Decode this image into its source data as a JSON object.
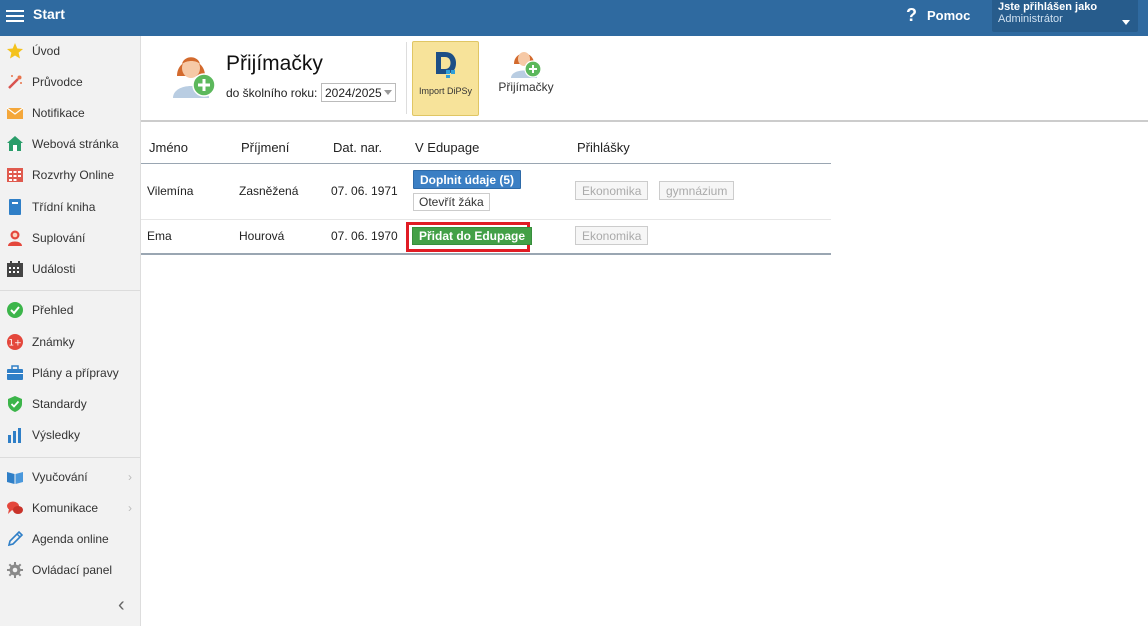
{
  "topbar": {
    "title": "Start",
    "help_label": "Pomoc",
    "help_icon": "?",
    "user_label": "Jste přihlášen jako",
    "user_name": "Administrátor",
    "bg_color": "#2f6aa0"
  },
  "sidebar": {
    "items": [
      {
        "label": "Úvod",
        "icon": "star-icon"
      },
      {
        "label": "Průvodce",
        "icon": "magic-wand-icon"
      },
      {
        "label": "Notifikace",
        "icon": "envelope-icon"
      },
      {
        "label": "Webová stránka",
        "icon": "house-icon"
      },
      {
        "label": "Rozvrhy Online",
        "icon": "timetable-icon"
      },
      {
        "label": "Třídní kniha",
        "icon": "book-icon"
      },
      {
        "label": "Suplování",
        "icon": "substitute-person-icon"
      },
      {
        "label": "Události",
        "icon": "calendar-icon"
      },
      {
        "label": "Přehled",
        "icon": "check-circle-icon"
      },
      {
        "label": "Známky",
        "icon": "grades-icon"
      },
      {
        "label": "Plány a přípravy",
        "icon": "briefcase-icon"
      },
      {
        "label": "Standardy",
        "icon": "shield-check-icon"
      },
      {
        "label": "Výsledky",
        "icon": "bar-chart-icon"
      },
      {
        "label": "Vyučování",
        "icon": "open-book-icon",
        "arrow": "›"
      },
      {
        "label": "Komunikace",
        "icon": "chat-bubbles-icon",
        "arrow": "›"
      },
      {
        "label": "Agenda online",
        "icon": "pen-icon"
      },
      {
        "label": "Ovládací panel",
        "icon": "gear-icon"
      }
    ],
    "collapse_glyph": "‹"
  },
  "header": {
    "title": "Přijímačky",
    "year_label": "do školního roku:",
    "year_value": "2024/2025",
    "import_label": "Import DiPSy",
    "tool_label": "Přijímačky"
  },
  "table": {
    "columns": [
      "Jméno",
      "Příjmení",
      "Dat. nar.",
      "V Edupage",
      "Přihlášky"
    ],
    "rows": [
      {
        "first": "Vilemína",
        "last": "Zasněžená",
        "dob": "07. 06. 1971",
        "actions": [
          "Doplnit údaje (5)",
          "Otevřít žáka"
        ],
        "applications": [
          "Ekonomika",
          "gymnázium"
        ]
      },
      {
        "first": "Ema",
        "last": "Hourová",
        "dob": "07. 06. 1970",
        "actions": [
          "Přidat do Edupage"
        ],
        "applications": [
          "Ekonomika"
        ]
      }
    ]
  },
  "colors": {
    "accent_blue": "#3b7fc4",
    "accent_green": "#43a047",
    "highlight_red": "#e01b24",
    "import_yellow": "#f7e39a"
  }
}
